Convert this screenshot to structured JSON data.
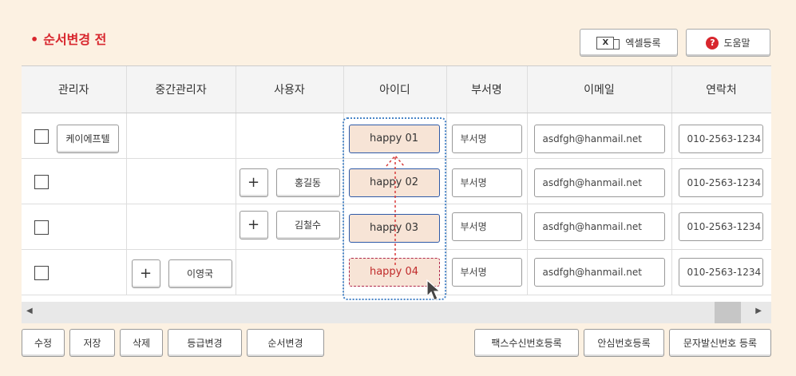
{
  "title": {
    "bullet": "•",
    "text": "순서변경 전"
  },
  "toolbar": {
    "excel_icon": "X",
    "excel_label": "엑셀등록",
    "help_icon": "?",
    "help_label": "도움말"
  },
  "columns": [
    "관리자",
    "중간관리자",
    "사용자",
    "아이디",
    "부서명",
    "이메일",
    "연락처"
  ],
  "rows": [
    {
      "manager": "케이에프텔",
      "mid_manager": "",
      "user": "",
      "id": "happy 01",
      "dept": "부서명",
      "email": "asdfgh@hanmail.net",
      "phone": "010-2563-1234"
    },
    {
      "manager": "",
      "mid_manager": "",
      "user": "홍길동",
      "id": "happy 02",
      "dept": "부서명",
      "email": "asdfgh@hanmail.net",
      "phone": "010-2563-1234"
    },
    {
      "manager": "",
      "mid_manager": "",
      "user": "김철수",
      "id": "happy 03",
      "dept": "부서명",
      "email": "asdfgh@hanmail.net",
      "phone": "010-2563-1234"
    },
    {
      "manager": "",
      "mid_manager": "이영국",
      "user": "",
      "id": "happy 04",
      "dept": "부서명",
      "email": "asdfgh@hanmail.net",
      "phone": "010-2563-1234"
    }
  ],
  "plus_label": "+",
  "scroll": {
    "left": "◀",
    "right": "▶"
  },
  "bottom_left": [
    "수정",
    "저장",
    "삭제",
    "등급변경",
    "순서변경"
  ],
  "bottom_right": [
    "팩스수신번호등록",
    "안심번호등록",
    "문자발신번호 등록"
  ],
  "colors": {
    "title": "#d8262d",
    "id_fill": "#f7e4d6",
    "id_border": "#2e5aa8",
    "drag_border": "#b0284d",
    "selection": "#4a86c8"
  }
}
